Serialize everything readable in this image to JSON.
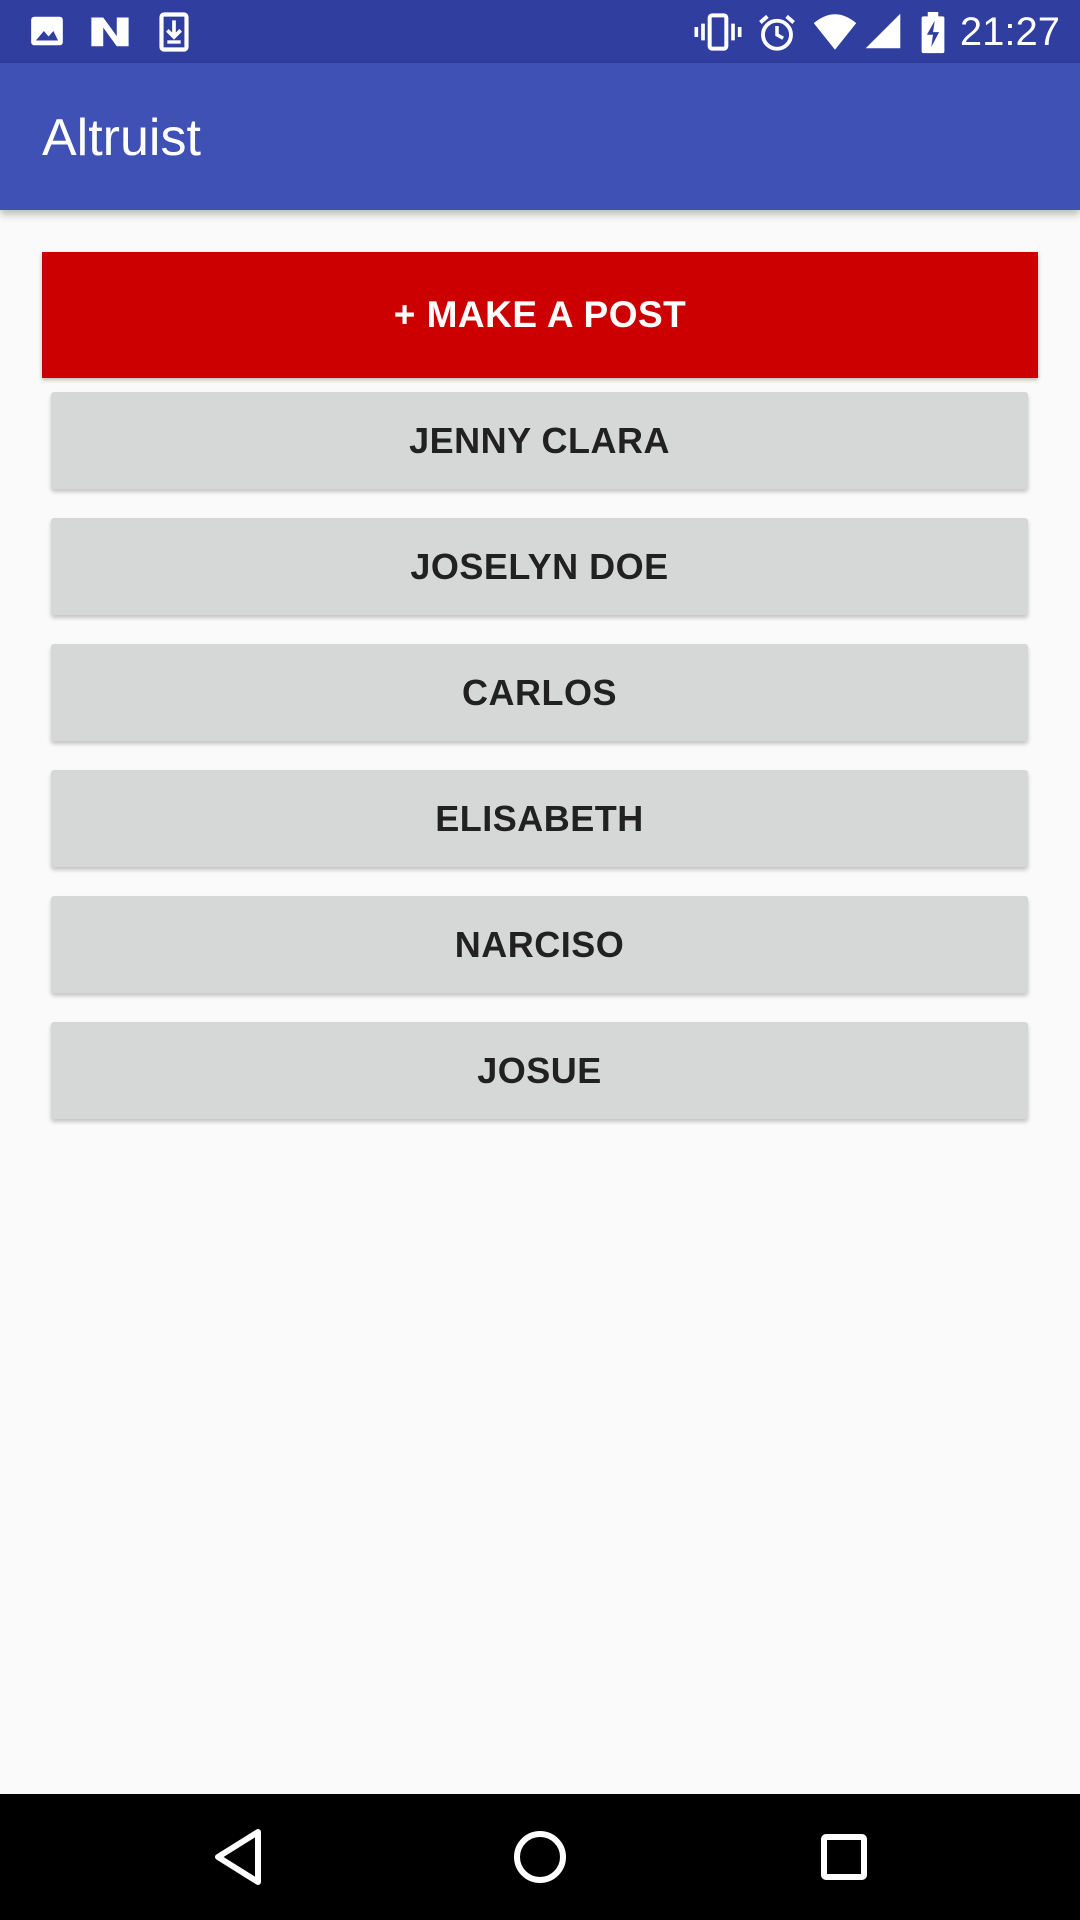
{
  "status_bar": {
    "time": "21:27",
    "left_icons": [
      "image-icon",
      "n-logo-icon",
      "download-icon"
    ],
    "right_icons": [
      "vibrate-icon",
      "alarm-icon",
      "wifi-icon",
      "signal-icon",
      "battery-charging-icon"
    ],
    "background": "#303f9f"
  },
  "app_bar": {
    "title": "Altruist",
    "background": "#3f51b5"
  },
  "main": {
    "post_button_label": "+ MAKE A POST",
    "post_button_color": "#cc0000",
    "users": [
      {
        "label": "JENNY CLARA"
      },
      {
        "label": "JOSELYN DOE"
      },
      {
        "label": "CARLOS"
      },
      {
        "label": "ELISABETH"
      },
      {
        "label": "NARCISO"
      },
      {
        "label": "JOSUE"
      }
    ]
  },
  "nav_bar": {
    "buttons": [
      "back-icon",
      "home-icon",
      "recents-icon"
    ]
  }
}
